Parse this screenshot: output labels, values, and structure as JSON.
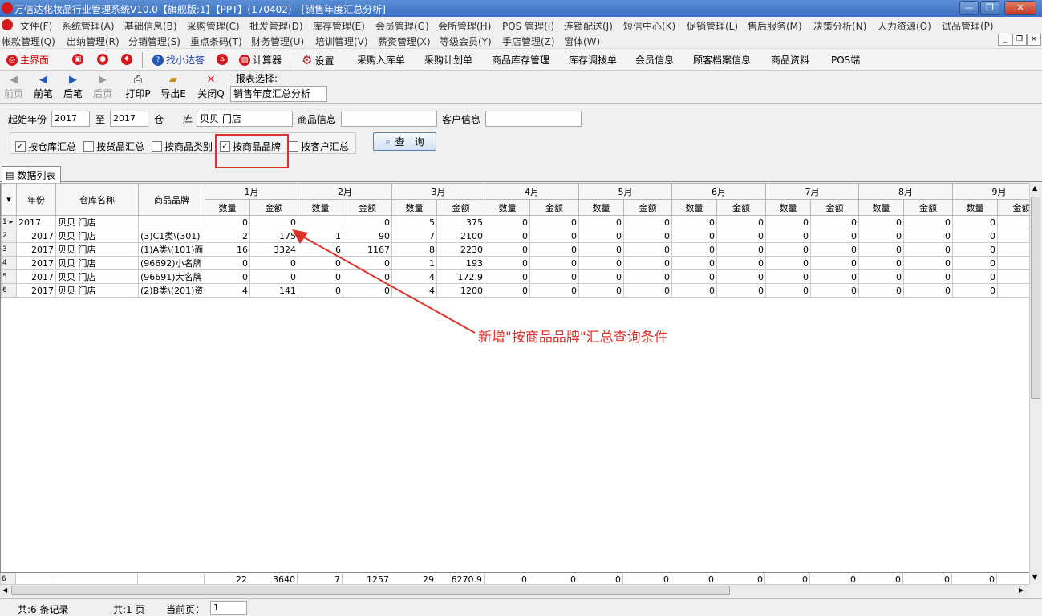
{
  "window": {
    "title": "万信达化妆品行业管理系统V10.0【旗舰版:1】【PPT】(170402) - [销售年度汇总分析]",
    "minimize": "—",
    "restore": "❐",
    "close": "✕"
  },
  "menu": {
    "row1": [
      "文件(F)",
      "系统管理(A)",
      "基础信息(B)",
      "采购管理(C)",
      "批发管理(D)",
      "库存管理(E)",
      "会员管理(G)",
      "会所管理(H)",
      "POS 管理(I)",
      "连锁配送(J)",
      "短信中心(K)",
      "促销管理(L)",
      "售后服务(M)",
      "决策分析(N)",
      "人力资源(O)",
      "试品管理(P)"
    ],
    "row2": [
      "帐款管理(Q)",
      "出纳管理(R)",
      "分销管理(S)",
      "重点条码(T)",
      "财务管理(U)",
      "培训管理(V)",
      "薪资管理(X)",
      "等级会员(Y)",
      "手店管理(Z)",
      "窗体(W)"
    ]
  },
  "toolbar1": {
    "home": "主界面",
    "find": "找小达答",
    "calc": "计算器",
    "settings": "设置",
    "links": [
      "采购入库单",
      "采购计划单",
      "商品库存管理",
      "库存调拨单",
      "会员信息",
      "顾客档案信息",
      "商品资料",
      "POS端"
    ]
  },
  "toolbar2": {
    "first": "前页",
    "prev": "前笔",
    "next": "后笔",
    "last": "后页",
    "print": "打印P",
    "export": "导出E",
    "close": "关闭Q",
    "report_label": "报表选择:",
    "report_value": "销售年度汇总分析"
  },
  "filter": {
    "start_year_label": "起始年份",
    "start_year": "2017",
    "to_label": "至",
    "end_year": "2017",
    "warehouse_label": "仓　　库",
    "warehouse": "贝贝 门店",
    "product_label": "商品信息",
    "product": "",
    "customer_label": "客户信息",
    "customer": "",
    "checks": [
      {
        "label": "按仓库汇总",
        "checked": true
      },
      {
        "label": "按货品汇总",
        "checked": false
      },
      {
        "label": "按商品类别",
        "checked": false
      },
      {
        "label": "按商品品牌",
        "checked": true
      },
      {
        "label": "按客户汇总",
        "checked": false
      }
    ],
    "query_button": "查　询"
  },
  "tab": "数据列表",
  "grid": {
    "col_year": "年份",
    "col_warehouse": "仓库名称",
    "col_brand": "商品品牌",
    "months": [
      "1月",
      "2月",
      "3月",
      "4月",
      "5月",
      "6月",
      "7月",
      "8月",
      "9月"
    ],
    "sub_qty": "数量",
    "sub_amt": "金额",
    "rows": [
      {
        "n": "1",
        "year": "2017",
        "wh": "贝贝 门店",
        "brand": "",
        "vals": [
          "0",
          "0",
          "",
          "0",
          "5",
          "375",
          "0",
          "0",
          "0",
          "0",
          "0",
          "0",
          "0",
          "0",
          "0",
          "0",
          "0",
          ""
        ]
      },
      {
        "n": "2",
        "year": "2017",
        "wh": "贝贝 门店",
        "brand": "(3)C1类\\(301)",
        "vals": [
          "2",
          "175",
          "1",
          "90",
          "7",
          "2100",
          "0",
          "0",
          "0",
          "0",
          "0",
          "0",
          "0",
          "0",
          "0",
          "0",
          "0",
          ""
        ]
      },
      {
        "n": "3",
        "year": "2017",
        "wh": "贝贝 门店",
        "brand": "(1)A类\\(101)面",
        "vals": [
          "16",
          "3324",
          "6",
          "1167",
          "8",
          "2230",
          "0",
          "0",
          "0",
          "0",
          "0",
          "0",
          "0",
          "0",
          "0",
          "0",
          "0",
          ""
        ]
      },
      {
        "n": "4",
        "year": "2017",
        "wh": "贝贝 门店",
        "brand": "(96692)小名牌",
        "vals": [
          "0",
          "0",
          "0",
          "0",
          "1",
          "193",
          "0",
          "0",
          "0",
          "0",
          "0",
          "0",
          "0",
          "0",
          "0",
          "0",
          "0",
          ""
        ]
      },
      {
        "n": "5",
        "year": "2017",
        "wh": "贝贝 门店",
        "brand": "(96691)大名牌",
        "vals": [
          "0",
          "0",
          "0",
          "0",
          "4",
          "172.9",
          "0",
          "0",
          "0",
          "0",
          "0",
          "0",
          "0",
          "0",
          "0",
          "0",
          "0",
          ""
        ]
      },
      {
        "n": "6",
        "year": "2017",
        "wh": "贝贝 门店",
        "brand": "(2)B类\\(201)资",
        "vals": [
          "4",
          "141",
          "0",
          "0",
          "4",
          "1200",
          "0",
          "0",
          "0",
          "0",
          "0",
          "0",
          "0",
          "0",
          "0",
          "0",
          "0",
          ""
        ]
      }
    ],
    "footer": {
      "n": "6",
      "vals": [
        "22",
        "3640",
        "7",
        "1257",
        "29",
        "6270.9",
        "0",
        "0",
        "0",
        "0",
        "0",
        "0",
        "0",
        "0",
        "0",
        "0",
        "0",
        ""
      ]
    }
  },
  "status": {
    "records": "共:6 条记录",
    "pages": "共:1 页",
    "current_label": "当前页：",
    "current": "1"
  },
  "annotation": "新增\"按商品品牌\"汇总查询条件",
  "colors": {
    "accent_red": "#e0302a",
    "title_blue": "#3a6fc0"
  }
}
